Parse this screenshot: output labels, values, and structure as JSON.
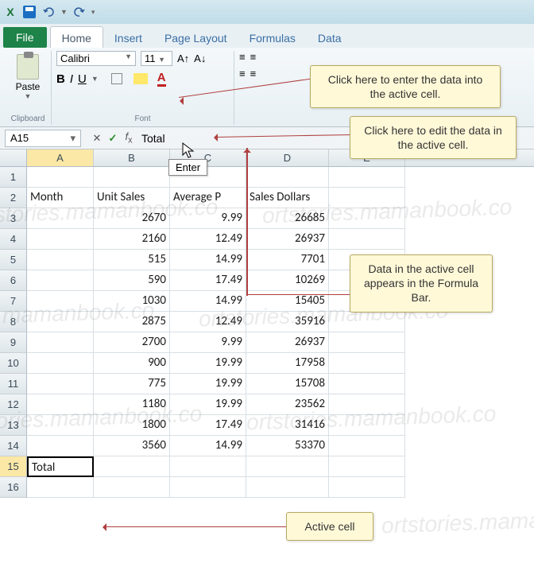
{
  "qat": {
    "items": [
      "excel-logo",
      "save",
      "undo",
      "redo"
    ]
  },
  "tabs": {
    "file": "File",
    "items": [
      "Home",
      "Insert",
      "Page Layout",
      "Formulas",
      "Data"
    ],
    "active": 0
  },
  "ribbon": {
    "paste_label": "Paste",
    "clipboard_group": "Clipboard",
    "font_name": "Calibri",
    "font_size": "11",
    "font_group": "Font",
    "bold": "B",
    "italic": "I",
    "underline": "U"
  },
  "namebox": {
    "value": "A15"
  },
  "formula_bar": {
    "value": "Total",
    "tooltip": "Enter"
  },
  "columns": [
    "A",
    "B",
    "C",
    "D",
    "E"
  ],
  "rows": [
    {
      "n": 1,
      "A": "",
      "B": "",
      "C": "",
      "D": "",
      "E": ""
    },
    {
      "n": 2,
      "A": "Month",
      "B": "Unit Sales",
      "C": "Average P",
      "D": "Sales Dollars",
      "E": ""
    },
    {
      "n": 3,
      "A": "",
      "B": "2670",
      "C": "9.99",
      "D": "26685",
      "E": ""
    },
    {
      "n": 4,
      "A": "",
      "B": "2160",
      "C": "12.49",
      "D": "26937",
      "E": ""
    },
    {
      "n": 5,
      "A": "",
      "B": "515",
      "C": "14.99",
      "D": "7701",
      "E": ""
    },
    {
      "n": 6,
      "A": "",
      "B": "590",
      "C": "17.49",
      "D": "10269",
      "E": ""
    },
    {
      "n": 7,
      "A": "",
      "B": "1030",
      "C": "14.99",
      "D": "15405",
      "E": ""
    },
    {
      "n": 8,
      "A": "",
      "B": "2875",
      "C": "12.49",
      "D": "35916",
      "E": ""
    },
    {
      "n": 9,
      "A": "",
      "B": "2700",
      "C": "9.99",
      "D": "26937",
      "E": ""
    },
    {
      "n": 10,
      "A": "",
      "B": "900",
      "C": "19.99",
      "D": "17958",
      "E": ""
    },
    {
      "n": 11,
      "A": "",
      "B": "775",
      "C": "19.99",
      "D": "15708",
      "E": ""
    },
    {
      "n": 12,
      "A": "",
      "B": "1180",
      "C": "19.99",
      "D": "23562",
      "E": ""
    },
    {
      "n": 13,
      "A": "",
      "B": "1800",
      "C": "17.49",
      "D": "31416",
      "E": ""
    },
    {
      "n": 14,
      "A": "",
      "B": "3560",
      "C": "14.99",
      "D": "53370",
      "E": ""
    },
    {
      "n": 15,
      "A": "Total",
      "B": "",
      "C": "",
      "D": "",
      "E": ""
    },
    {
      "n": 16,
      "A": "",
      "B": "",
      "C": "",
      "D": "",
      "E": ""
    }
  ],
  "active_cell": {
    "row": 15,
    "col": "A"
  },
  "callouts": {
    "enter": "Click here to enter\nthe data into the active cell.",
    "edit": "Click here to edit the\ndata in the active cell.",
    "fbar": "Data in the active\ncell appears in\nthe Formula Bar.",
    "active": "Active cell"
  },
  "watermark_text": "ortstories.mamanbook.co"
}
